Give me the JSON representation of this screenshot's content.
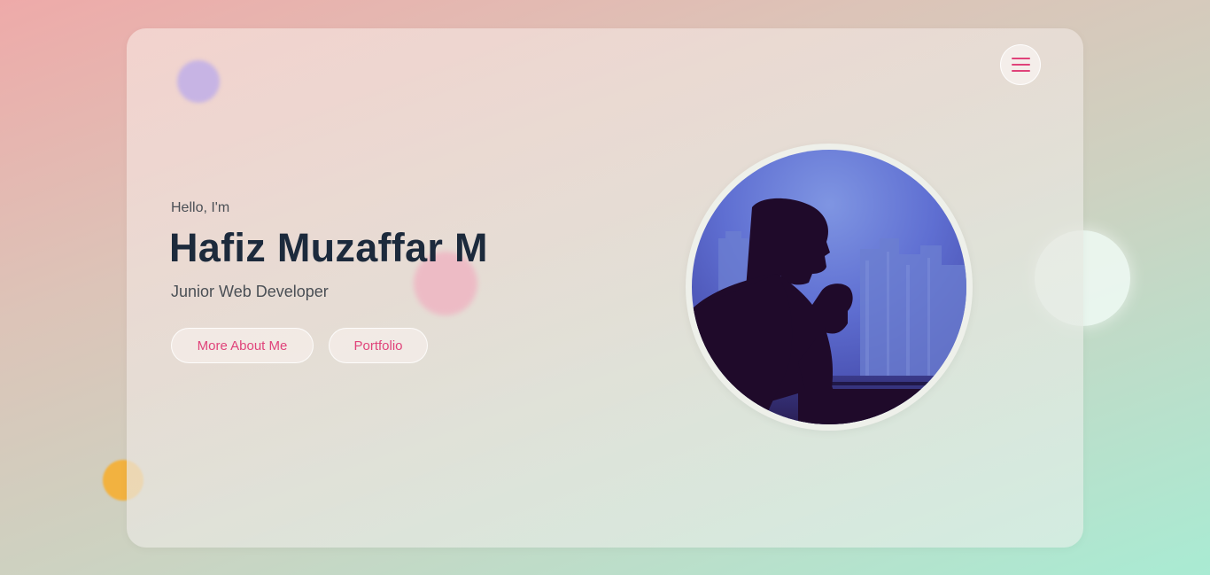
{
  "hero": {
    "greeting": "Hello, I'm",
    "name": "Hafiz Muzaffar M",
    "role": "Junior Web Developer"
  },
  "buttons": {
    "about_label": "More About Me",
    "portfolio_label": "Portfolio"
  },
  "menu": {
    "icon": "hamburger-menu-icon"
  },
  "colors": {
    "accent": "#e0437a",
    "heading": "#1c2a3c",
    "text": "#4a4f55"
  }
}
